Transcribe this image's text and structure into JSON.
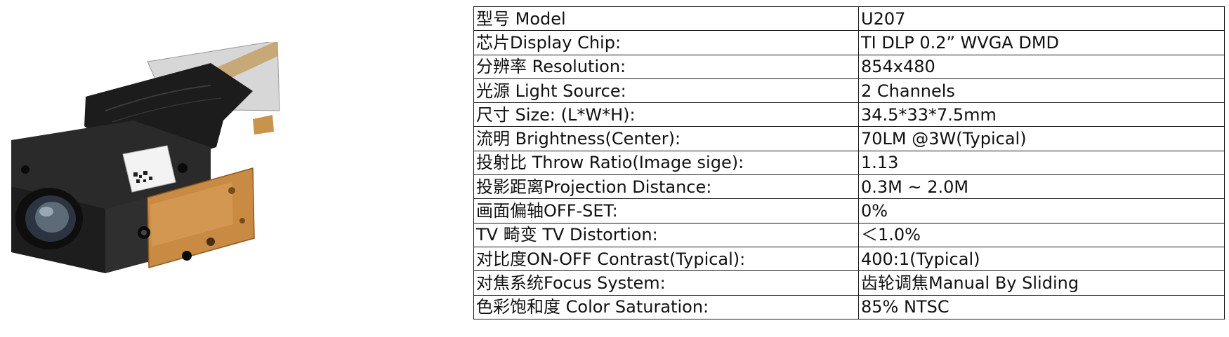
{
  "product": {
    "image_icon": "projector-module-image"
  },
  "specs": [
    {
      "label": "型号 Model",
      "value": "U207"
    },
    {
      "label": "芯片Display Chip:",
      "value": "TI DLP 0.2”  WVGA DMD"
    },
    {
      "label": "分辨率  Resolution:",
      "value": "854x480"
    },
    {
      "label": "光源 Light Source:",
      "value": "2 Channels"
    },
    {
      "label": "尺寸 Size: (L*W*H):",
      "value": "34.5*33*7.5mm"
    },
    {
      "label": "流明 Brightness(Center):",
      "value": "70LM @3W(Typical)"
    },
    {
      "label": "投射比 Throw Ratio(Image sige):",
      "value": "1.13"
    },
    {
      "label": "投影距离Projection Distance:",
      "value": "0.3M ~ 2.0M"
    },
    {
      "label": "画面偏轴OFF-SET:",
      "value": "0%"
    },
    {
      "label": "TV 畸变 TV Distortion:",
      "value": "＜1.0%"
    },
    {
      "label": "对比度ON-OFF Contrast(Typical):",
      "value": "400:1(Typical)"
    },
    {
      "label": "对焦系统Focus System:",
      "value": "齿轮调焦Manual By Sliding"
    },
    {
      "label": "色彩饱和度 Color Saturation:",
      "value": "85% NTSC"
    }
  ]
}
